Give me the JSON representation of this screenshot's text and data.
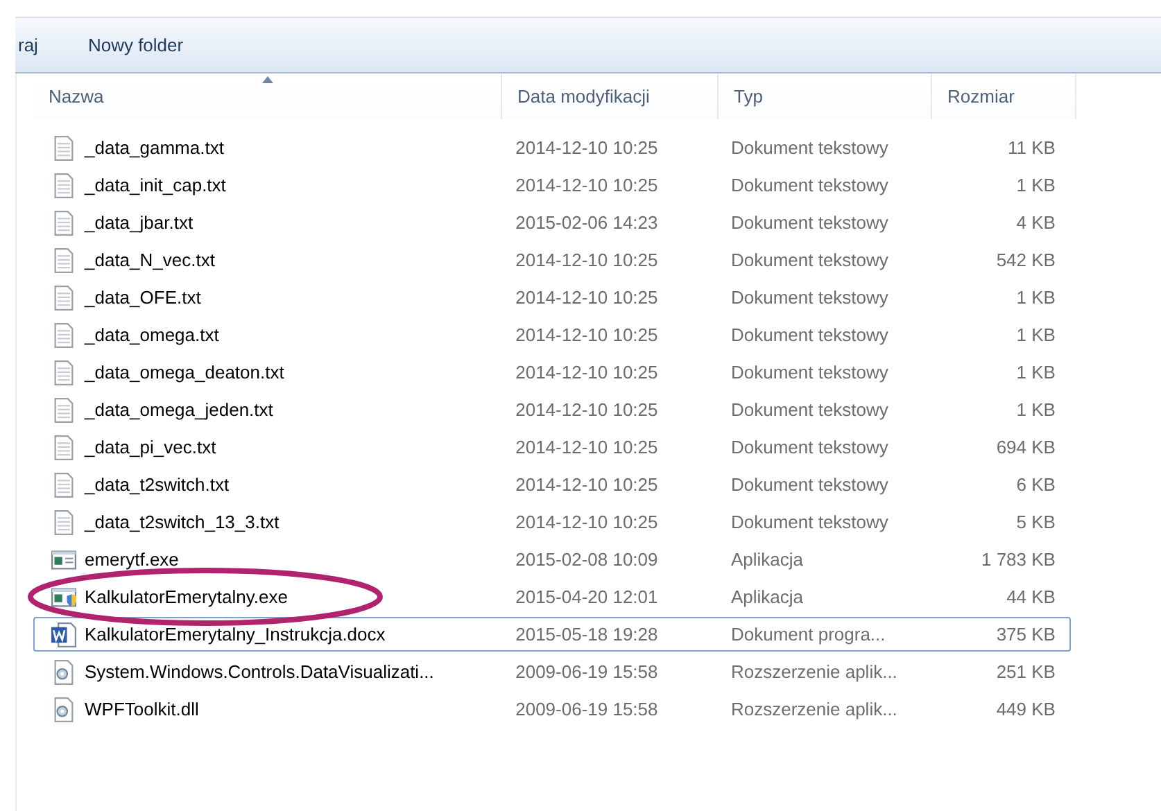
{
  "toolbar": {
    "items": [
      "raj",
      "Nowy folder"
    ]
  },
  "columns": [
    {
      "label": "Nazwa",
      "sorted": true
    },
    {
      "label": "Data modyfikacji",
      "sorted": false
    },
    {
      "label": "Typ",
      "sorted": false
    },
    {
      "label": "Rozmiar",
      "sorted": false
    }
  ],
  "rows": [
    {
      "kind": "text",
      "name": "_data_gamma.txt",
      "date": "2014-12-10 10:25",
      "type": "Dokument tekstowy",
      "size": "11 KB",
      "focused": false,
      "circled": false
    },
    {
      "kind": "text",
      "name": "_data_init_cap.txt",
      "date": "2014-12-10 10:25",
      "type": "Dokument tekstowy",
      "size": "1 KB",
      "focused": false,
      "circled": false
    },
    {
      "kind": "text",
      "name": "_data_jbar.txt",
      "date": "2015-02-06 14:23",
      "type": "Dokument tekstowy",
      "size": "4 KB",
      "focused": false,
      "circled": false
    },
    {
      "kind": "text",
      "name": "_data_N_vec.txt",
      "date": "2014-12-10 10:25",
      "type": "Dokument tekstowy",
      "size": "542 KB",
      "focused": false,
      "circled": false
    },
    {
      "kind": "text",
      "name": "_data_OFE.txt",
      "date": "2014-12-10 10:25",
      "type": "Dokument tekstowy",
      "size": "1 KB",
      "focused": false,
      "circled": false
    },
    {
      "kind": "text",
      "name": "_data_omega.txt",
      "date": "2014-12-10 10:25",
      "type": "Dokument tekstowy",
      "size": "1 KB",
      "focused": false,
      "circled": false
    },
    {
      "kind": "text",
      "name": "_data_omega_deaton.txt",
      "date": "2014-12-10 10:25",
      "type": "Dokument tekstowy",
      "size": "1 KB",
      "focused": false,
      "circled": false
    },
    {
      "kind": "text",
      "name": "_data_omega_jeden.txt",
      "date": "2014-12-10 10:25",
      "type": "Dokument tekstowy",
      "size": "1 KB",
      "focused": false,
      "circled": false
    },
    {
      "kind": "text",
      "name": "_data_pi_vec.txt",
      "date": "2014-12-10 10:25",
      "type": "Dokument tekstowy",
      "size": "694 KB",
      "focused": false,
      "circled": false
    },
    {
      "kind": "text",
      "name": "_data_t2switch.txt",
      "date": "2014-12-10 10:25",
      "type": "Dokument tekstowy",
      "size": "6 KB",
      "focused": false,
      "circled": false
    },
    {
      "kind": "text",
      "name": "_data_t2switch_13_3.txt",
      "date": "2014-12-10 10:25",
      "type": "Dokument tekstowy",
      "size": "5 KB",
      "focused": false,
      "circled": false
    },
    {
      "kind": "exe",
      "name": "emerytf.exe",
      "date": "2015-02-08 10:09",
      "type": "Aplikacja",
      "size": "1 783 KB",
      "focused": false,
      "circled": false
    },
    {
      "kind": "exe-shield",
      "name": "KalkulatorEmerytalny.exe",
      "date": "2015-04-20 12:01",
      "type": "Aplikacja",
      "size": "44 KB",
      "focused": false,
      "circled": true
    },
    {
      "kind": "word",
      "name": "KalkulatorEmerytalny_Instrukcja.docx",
      "date": "2015-05-18 19:28",
      "type": "Dokument progra...",
      "size": "375 KB",
      "focused": true,
      "circled": false
    },
    {
      "kind": "dll",
      "name": "System.Windows.Controls.DataVisualizati...",
      "date": "2009-06-19 15:58",
      "type": "Rozszerzenie aplik...",
      "size": "251 KB",
      "focused": false,
      "circled": false
    },
    {
      "kind": "dll",
      "name": "WPFToolkit.dll",
      "date": "2009-06-19 15:58",
      "type": "Rozszerzenie aplik...",
      "size": "449 KB",
      "focused": false,
      "circled": false
    }
  ]
}
